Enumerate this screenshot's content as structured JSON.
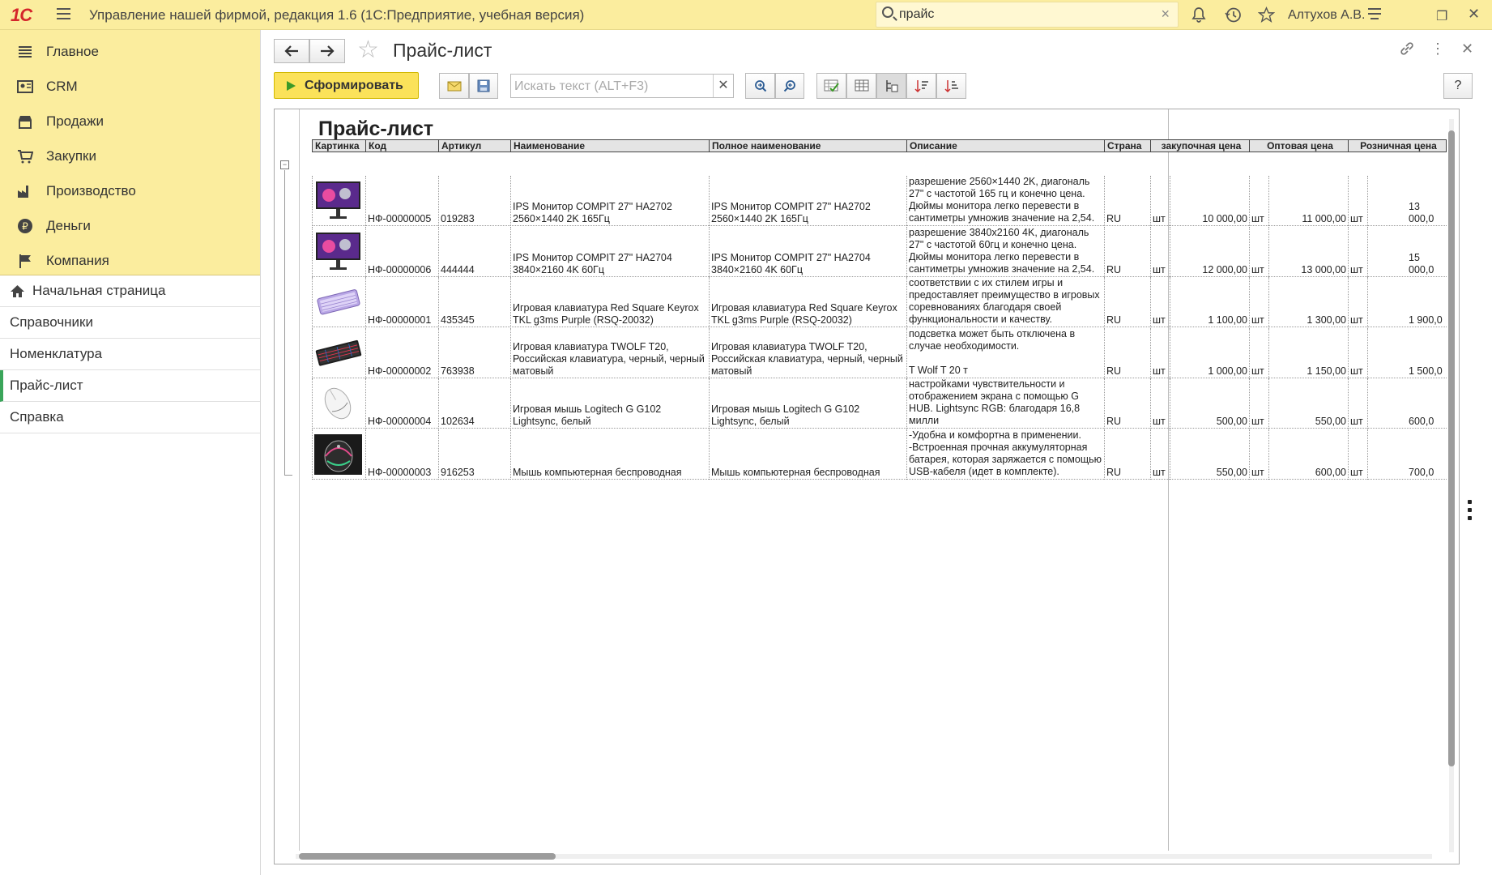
{
  "app": {
    "logo": "1С",
    "title": "Управление нашей фирмой, редакция 1.6  (1С:Предприятие, учебная версия)",
    "search_value": "прайс",
    "user": "Алтухов А.В."
  },
  "sidebar": {
    "main_items": [
      {
        "label": "Главное",
        "icon": "menu-lines-icon"
      },
      {
        "label": "CRM",
        "icon": "contacts-icon"
      },
      {
        "label": "Продажи",
        "icon": "shop-icon"
      },
      {
        "label": "Закупки",
        "icon": "cart-icon"
      },
      {
        "label": "Производство",
        "icon": "factory-icon"
      },
      {
        "label": "Деньги",
        "icon": "ruble-icon"
      },
      {
        "label": "Компания",
        "icon": "flag-icon"
      }
    ],
    "sections": [
      {
        "label": "Начальная страница",
        "icon": "home-icon"
      },
      {
        "label": "Справочники"
      },
      {
        "label": "Номенклатура"
      },
      {
        "label": "Прайс-лист",
        "active": true
      },
      {
        "label": "Справка"
      }
    ]
  },
  "page": {
    "title": "Прайс-лист",
    "generate_label": "Сформировать",
    "search_placeholder": "Искать текст (ALT+F3)",
    "help_label": "?"
  },
  "report": {
    "title": "Прайс-лист",
    "headers": [
      "Картинка",
      "Код",
      "Артикул",
      "Наименование",
      "Полное наименование",
      "Описание",
      "Страна",
      "закупочная цена",
      "Оптовая цена",
      "Розничная цена"
    ],
    "rows": [
      {
        "image": "monitor",
        "code": "НФ-00000005",
        "article": "019283",
        "name": "IPS Монитор COMPIT 27\" HA2702 2560×1440 2K 165Гц",
        "full_name": "IPS Монитор COMPIT 27\" HA2702 2560×1440 2K 165Гц",
        "desc": "разрешение 2560×1440 2K, диагональ 27\" с частотой 165 гц и конечно цена. Дюймы монитора легко перевести в сантиметры умножив значение на 2,54.",
        "country": "RU",
        "u1": "шт",
        "p1": "10 000,00",
        "u2": "шт",
        "p2": "11 000,00",
        "u3": "шт",
        "p3": "13 000,0"
      },
      {
        "image": "monitor",
        "code": "НФ-00000006",
        "article": "444444",
        "name": "IPS Монитор COMPIT 27\" HA2704 3840×2160 4K 60Гц",
        "full_name": "IPS Монитор COMPIT 27\" HA2704 3840×2160 4K 60Гц",
        "desc": "разрешение 3840х2160 4K, диагональ 27\" с частотой 60гц и конечно цена. Дюймы монитора легко перевести в сантиметры умножив значение на 2,54.",
        "country": "RU",
        "u1": "шт",
        "p1": "12 000,00",
        "u2": "шт",
        "p2": "13 000,00",
        "u3": "шт",
        "p3": "15 000,0"
      },
      {
        "image": "keyboard-purple",
        "code": "НФ-00000001",
        "article": "435345",
        "name": "Игровая клавиатура Red Square Keyrox TKL g3ms Purple (RSQ-20032)",
        "full_name": "Игровая клавиатура Red Square Keyrox TKL g3ms Purple (RSQ-20032)",
        "desc": "соответствии с их стилем игры и предоставляет преимущество в игровых соревнованиях благодаря своей функциональности и качеству.",
        "country": "RU",
        "u1": "шт",
        "p1": "1 100,00",
        "u2": "шт",
        "p2": "1 300,00",
        "u3": "шт",
        "p3": "1 900,0"
      },
      {
        "image": "keyboard-black",
        "code": "НФ-00000002",
        "article": "763938",
        "name": "Игровая клавиатура TWOLF T20, Российская клавиатура, черный, черный матовый",
        "full_name": "Игровая клавиатура TWOLF T20, Российская клавиатура, черный, черный матовый",
        "desc": "подсветка может быть отключена в случае необходимости.\n\nT Wolf T 20 т",
        "country": "RU",
        "u1": "шт",
        "p1": "1 000,00",
        "u2": "шт",
        "p2": "1 150,00",
        "u3": "шт",
        "p3": "1 500,0"
      },
      {
        "image": "mouse-white",
        "code": "НФ-00000004",
        "article": "102634",
        "name": "Игровая мышь Logitech G G102 Lightsync, белый",
        "full_name": "Игровая мышь Logitech G G102 Lightsync, белый",
        "desc": "настройками чувствительности и отображением экрана с помощью G HUB. Lightsync RGB: благодаря 16,8 милли",
        "country": "RU",
        "u1": "шт",
        "p1": "500,00",
        "u2": "шт",
        "p2": "550,00",
        "u3": "шт",
        "p3": "600,0"
      },
      {
        "image": "mouse-rgb",
        "code": "НФ-00000003",
        "article": "916253",
        "name": "Мышь компьютерная беспроводная",
        "full_name": "Мышь компьютерная беспроводная",
        "desc": "-Удобна и комфортна в применении. -Встроенная прочная аккумуляторная батарея, которая заряжается с помощью USB-кабеля (идет в комплекте).",
        "country": "RU",
        "u1": "шт",
        "p1": "550,00",
        "u2": "шт",
        "p2": "600,00",
        "u3": "шт",
        "p3": "700,0"
      }
    ]
  },
  "colors": {
    "accent": "#fbed9e",
    "button": "#fbe25a",
    "active_marker": "#3aa55a"
  }
}
